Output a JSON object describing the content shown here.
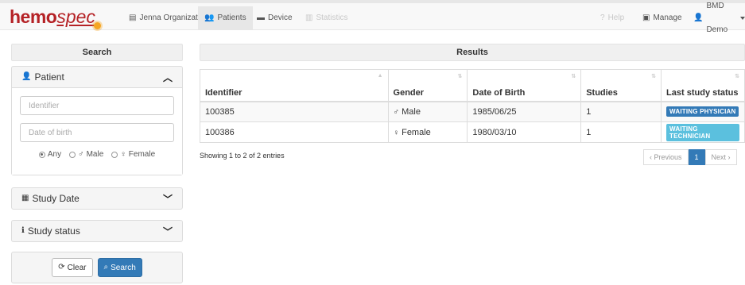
{
  "brand": {
    "part1": "hemo",
    "part2": "spec"
  },
  "nav": {
    "organization": "Jenna Organization",
    "patients": "Patients",
    "device": "Device",
    "statistics": "Statistics",
    "help": "Help",
    "manage": "Manage",
    "user": "BMD Demo"
  },
  "search": {
    "heading": "Search",
    "patient": {
      "title": "Patient",
      "identifier_placeholder": "Identifier",
      "dob_placeholder": "Date of birth",
      "gender_options": [
        "Any",
        "Male",
        "Female"
      ],
      "gender_selected": "Any"
    },
    "study_date": {
      "title": "Study Date"
    },
    "study_status": {
      "title": "Study status"
    },
    "clear_label": "Clear",
    "search_label": "Search"
  },
  "results": {
    "heading": "Results",
    "columns": [
      "Identifier",
      "Gender",
      "Date of Birth",
      "Studies",
      "Last study status"
    ],
    "rows": [
      {
        "identifier": "100385",
        "gender": "Male",
        "dob": "1985/06/25",
        "studies": "1",
        "status": "WAITING PHYSICIAN",
        "status_color": "#337ab7"
      },
      {
        "identifier": "100386",
        "gender": "Female",
        "dob": "1980/03/10",
        "studies": "1",
        "status": "WAITING TECHNICIAN",
        "status_color": "#5bc0de"
      }
    ],
    "info": "Showing 1 to 2 of 2 entries",
    "pager": {
      "previous": "Previous",
      "current": "1",
      "next": "Next"
    }
  },
  "colors": {
    "brand_red": "#b52226",
    "primary": "#337ab7",
    "info": "#5bc0de",
    "logo_sun": "#f5a623"
  }
}
